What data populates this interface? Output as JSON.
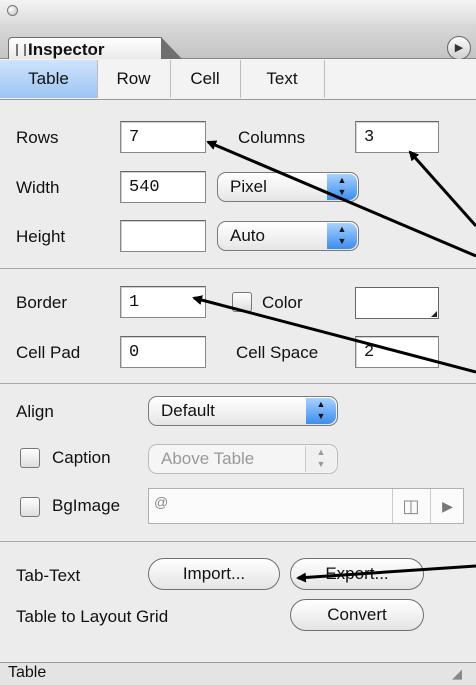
{
  "inspector": {
    "title": "Inspector",
    "options_icon": "circle-arrow-icon"
  },
  "tabs": [
    "Table",
    "Row",
    "Cell",
    "Text"
  ],
  "table_props": {
    "rows_label": "Rows",
    "rows_value": "7",
    "columns_label": "Columns",
    "columns_value": "3",
    "width_label": "Width",
    "width_value": "540",
    "width_unit": "Pixel",
    "height_label": "Height",
    "height_value": "",
    "height_unit": "Auto"
  },
  "border_props": {
    "border_label": "Border",
    "border_value": "1",
    "color_label": "Color",
    "cellpad_label": "Cell Pad",
    "cellpad_value": "0",
    "cellspace_label": "Cell Space",
    "cellspace_value": "2"
  },
  "align_props": {
    "align_label": "Align",
    "align_value": "Default",
    "caption_label": "Caption",
    "caption_value": "Above Table",
    "bgimage_label": "BgImage",
    "bgimage_at": "@"
  },
  "actions": {
    "tabtext_label": "Tab-Text",
    "import_label": "Import...",
    "export_label": "Export...",
    "layout_label": "Table to Layout Grid",
    "convert_label": "Convert"
  },
  "status": {
    "text": "Table"
  },
  "accent_color": "#3a8ef0"
}
